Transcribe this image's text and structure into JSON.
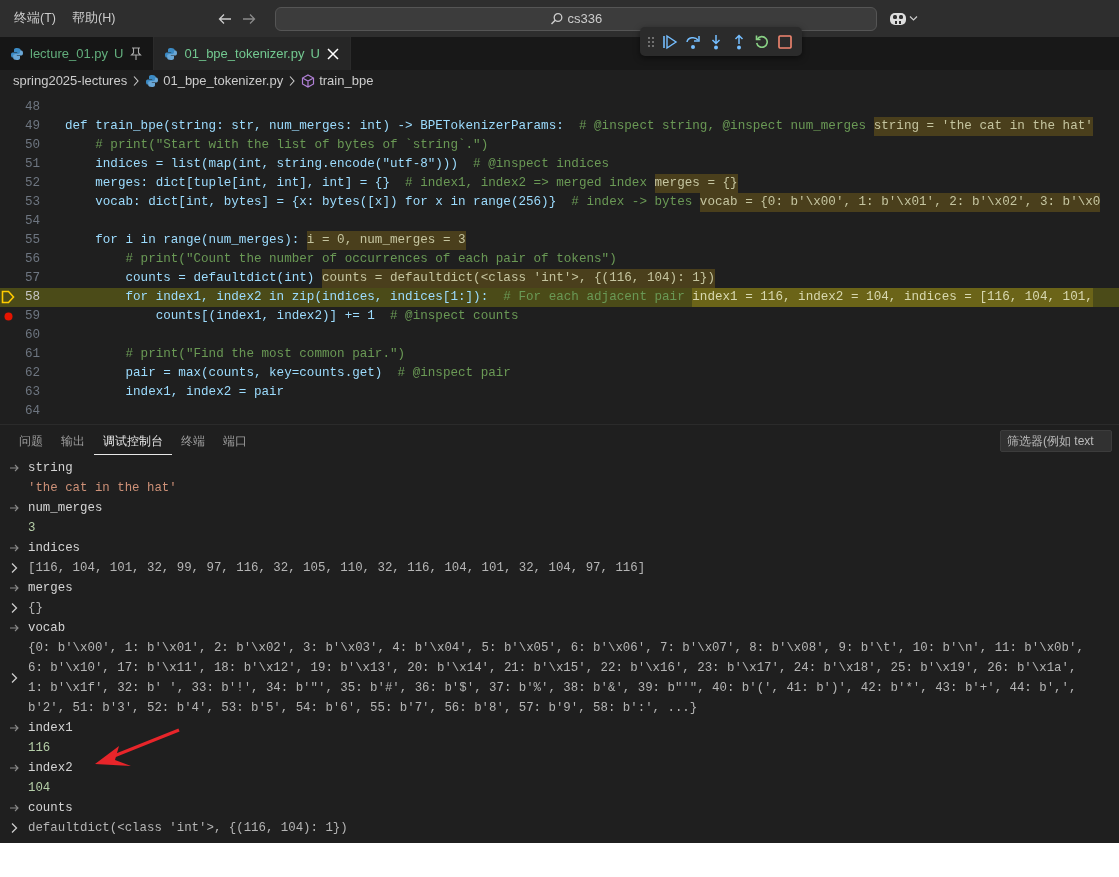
{
  "menu": [
    {
      "label": "终端(T)"
    },
    {
      "label": "帮助(H)"
    }
  ],
  "search": {
    "value": "cs336"
  },
  "debug_toolbar": [
    {
      "kind": "continue"
    },
    {
      "kind": "step_over"
    },
    {
      "kind": "step_into"
    },
    {
      "kind": "step_out"
    },
    {
      "kind": "restart"
    },
    {
      "kind": "stop"
    }
  ],
  "tabs": [
    {
      "label": "lecture_01.py",
      "status": "U",
      "selected": false,
      "pinned": true
    },
    {
      "label": "01_bpe_tokenizer.py",
      "status": "U",
      "selected": true,
      "pinned": false
    }
  ],
  "breadcrumb": [
    {
      "kind": "folder",
      "label": "spring2025-lectures"
    },
    {
      "kind": "file",
      "label": "01_bpe_tokenizer.py"
    },
    {
      "kind": "symbol",
      "label": "train_bpe"
    }
  ],
  "editor_lines": [
    {
      "number": "48",
      "current": false,
      "breakpoint": false
    },
    {
      "number": "49",
      "current": false,
      "breakpoint": false,
      "segments": [
        {
          "kind": "code",
          "text": "def train_bpe(string: str, num_merges: int) -> BPETokenizerParams:  "
        },
        {
          "kind": "comment",
          "text": "# @inspect string, @inspect num_merges "
        },
        {
          "kind": "value",
          "text": "string = 'the cat in the hat'"
        }
      ]
    },
    {
      "number": "50",
      "current": false,
      "breakpoint": false,
      "segments": [
        {
          "kind": "comment",
          "text": "    # print(\"Start with the list of bytes of `string`.\")"
        }
      ]
    },
    {
      "number": "51",
      "current": false,
      "breakpoint": false,
      "segments": [
        {
          "kind": "code",
          "text": "    indices = list(map(int, string.encode(\"utf-8\")))  "
        },
        {
          "kind": "comment",
          "text": "# @inspect indices"
        }
      ]
    },
    {
      "number": "52",
      "current": false,
      "breakpoint": false,
      "segments": [
        {
          "kind": "code",
          "text": "    merges: dict[tuple[int, int], int] = {}  "
        },
        {
          "kind": "comment",
          "text": "# index1, index2 => merged index "
        },
        {
          "kind": "value",
          "text": "merges = {}"
        }
      ]
    },
    {
      "number": "53",
      "current": false,
      "breakpoint": false,
      "segments": [
        {
          "kind": "code",
          "text": "    vocab: dict[int, bytes] = {x: bytes([x]) for x in range(256)}  "
        },
        {
          "kind": "comment",
          "text": "# index -> bytes "
        },
        {
          "kind": "value",
          "text": "vocab = {0: b'\\x00', 1: b'\\x01', 2: b'\\x02', 3: b'\\x0"
        }
      ]
    },
    {
      "number": "54",
      "current": false,
      "breakpoint": false
    },
    {
      "number": "55",
      "current": false,
      "breakpoint": false,
      "segments": [
        {
          "kind": "code",
          "text": "    for i in range(num_merges): "
        },
        {
          "kind": "value",
          "text": "i = 0, num_merges = 3"
        }
      ]
    },
    {
      "number": "56",
      "current": false,
      "breakpoint": false,
      "segments": [
        {
          "kind": "comment",
          "text": "        # print(\"Count the number of occurrences of each pair of tokens\")"
        }
      ]
    },
    {
      "number": "57",
      "current": false,
      "breakpoint": false,
      "segments": [
        {
          "kind": "code",
          "text": "        counts = defaultdict(int) "
        },
        {
          "kind": "value",
          "text": "counts = defaultdict(<class 'int'>, {(116, 104): 1})"
        }
      ]
    },
    {
      "number": "58",
      "current": true,
      "breakpoint": false,
      "segments": [
        {
          "kind": "code",
          "text": "        for index1, index2 in zip(indices, indices[1:]):  "
        },
        {
          "kind": "comment",
          "text": "# For each adjacent pair "
        },
        {
          "kind": "value",
          "text": "index1 = 116, index2 = 104, indices = [116, 104, 101,"
        }
      ]
    },
    {
      "number": "59",
      "current": false,
      "breakpoint": true,
      "segments": [
        {
          "kind": "code",
          "text": "            counts[(index1, index2)] += 1  "
        },
        {
          "kind": "comment",
          "text": "# @inspect counts"
        }
      ]
    },
    {
      "number": "60",
      "current": false,
      "breakpoint": false
    },
    {
      "number": "61",
      "current": false,
      "breakpoint": false,
      "segments": [
        {
          "kind": "comment",
          "text": "        # print(\"Find the most common pair.\")"
        }
      ]
    },
    {
      "number": "62",
      "current": false,
      "breakpoint": false,
      "segments": [
        {
          "kind": "code",
          "text": "        pair = max(counts, key=counts.get)  "
        },
        {
          "kind": "comment",
          "text": "# @inspect pair"
        }
      ]
    },
    {
      "number": "63",
      "current": false,
      "breakpoint": false,
      "segments": [
        {
          "kind": "code",
          "text": "        index1, index2 = pair"
        }
      ]
    },
    {
      "number": "64",
      "current": false,
      "breakpoint": false
    }
  ],
  "panel_tabs": [
    {
      "label": "问题",
      "selected": false
    },
    {
      "label": "输出",
      "selected": false
    },
    {
      "label": "调试控制台",
      "selected": true
    },
    {
      "label": "终端",
      "selected": false
    },
    {
      "label": "端口",
      "selected": false
    }
  ],
  "filter": {
    "placeholder": "筛选器(例如 text"
  },
  "console": [
    {
      "kind": "input",
      "text": "string"
    },
    {
      "kind": "string",
      "expandable": false,
      "lines": [
        "'the cat in the hat'"
      ]
    },
    {
      "kind": "input",
      "text": "num_merges"
    },
    {
      "kind": "number",
      "expandable": false,
      "lines": [
        "3"
      ]
    },
    {
      "kind": "input",
      "text": "indices"
    },
    {
      "kind": "object",
      "expandable": true,
      "lines": [
        "[116, 104, 101, 32, 99, 97, 116, 32, 105, 110, 32, 116, 104, 101, 32, 104, 97, 116]"
      ]
    },
    {
      "kind": "input",
      "text": "merges"
    },
    {
      "kind": "object",
      "expandable": true,
      "lines": [
        "{}"
      ]
    },
    {
      "kind": "input",
      "text": "vocab"
    },
    {
      "kind": "object",
      "expandable": true,
      "lines": [
        "{0: b'\\x00', 1: b'\\x01', 2: b'\\x02', 3: b'\\x03', 4: b'\\x04', 5: b'\\x05', 6: b'\\x06', 7: b'\\x07', 8: b'\\x08', 9: b'\\t', 10: b'\\n', 11: b'\\x0b',",
        "6: b'\\x10', 17: b'\\x11', 18: b'\\x12', 19: b'\\x13', 20: b'\\x14', 21: b'\\x15', 22: b'\\x16', 23: b'\\x17', 24: b'\\x18', 25: b'\\x19', 26: b'\\x1a',",
        "1: b'\\x1f', 32: b' ', 33: b'!', 34: b'\"', 35: b'#', 36: b'$', 37: b'%', 38: b'&', 39: b\"'\", 40: b'(', 41: b')', 42: b'*', 43: b'+', 44: b',',",
        "b'2', 51: b'3', 52: b'4', 53: b'5', 54: b'6', 55: b'7', 56: b'8', 57: b'9', 58: b':', ...}"
      ]
    },
    {
      "kind": "input",
      "text": "index1"
    },
    {
      "kind": "number",
      "expandable": false,
      "lines": [
        "116"
      ]
    },
    {
      "kind": "input",
      "text": "index2"
    },
    {
      "kind": "number",
      "expandable": false,
      "lines": [
        "104"
      ]
    },
    {
      "kind": "input",
      "text": "counts"
    },
    {
      "kind": "object",
      "expandable": true,
      "lines": [
        "defaultdict(<class 'int'>, {(116, 104): 1})"
      ]
    }
  ]
}
